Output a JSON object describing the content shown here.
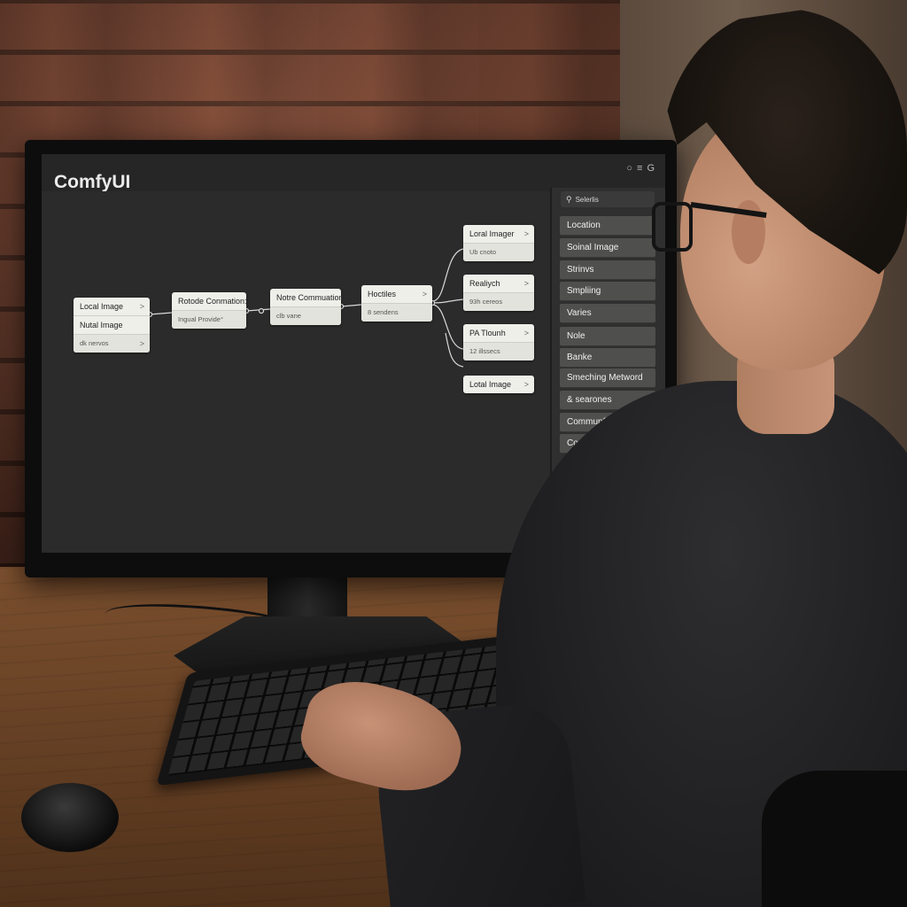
{
  "app": {
    "title": "ComfyUI",
    "top_icons": [
      "○",
      "≡",
      "G"
    ]
  },
  "canvas": {
    "nodes": [
      {
        "rows": [
          {
            "text": "Local Image",
            "chev": ">"
          },
          {
            "text": "Nutal Image",
            "chev": ""
          },
          {
            "text": "dk nervos",
            "chev": ">",
            "sub": true
          }
        ]
      },
      {
        "rows": [
          {
            "text": "Rotode Conmation:",
            "chev": ""
          },
          {
            "text": "Ingual Provide°",
            "chev": ""
          }
        ]
      },
      {
        "rows": [
          {
            "text": "Notre Commuation",
            "chev": ""
          },
          {
            "text": "clb vane",
            "chev": "",
            "sub": true
          }
        ]
      },
      {
        "rows": [
          {
            "text": "Hoctiles",
            "chev": ">"
          },
          {
            "text": "8 sendens",
            "chev": "",
            "sub": true
          }
        ]
      },
      {
        "rows": [
          {
            "text": "Loral Imager",
            "chev": ">"
          },
          {
            "text": "Ub cnoto",
            "chev": "",
            "sub": true
          }
        ]
      },
      {
        "rows": [
          {
            "text": "Realiych",
            "chev": ">"
          },
          {
            "text": "93h cereos",
            "chev": "",
            "sub": true
          }
        ]
      },
      {
        "rows": [
          {
            "text": "PA Tlounh",
            "chev": ">"
          },
          {
            "text": "12 illssecs",
            "chev": "",
            "sub": true
          }
        ]
      },
      {
        "rows": [
          {
            "text": "Lotal Image",
            "chev": ">"
          }
        ]
      }
    ]
  },
  "sidebar": {
    "search": {
      "icon": "search-icon",
      "text": "Selerlis"
    },
    "items": [
      {
        "label": "Location"
      },
      {
        "label": "Soinal Image"
      },
      {
        "label": "Strinvs"
      },
      {
        "label": "Smpliing"
      },
      {
        "label": "Varies"
      },
      {
        "label": "Nole"
      },
      {
        "label": "Banke"
      },
      {
        "label": "Smeching Metword"
      },
      {
        "label": "& searones"
      },
      {
        "label": "Communfing"
      },
      {
        "label": "Control"
      }
    ]
  },
  "colors": {
    "node_bg": "#efefea",
    "sidebar_item_bg": "#4f504e",
    "canvas_bg": "#2b2b2b",
    "link_color": "#d9d9d9"
  }
}
